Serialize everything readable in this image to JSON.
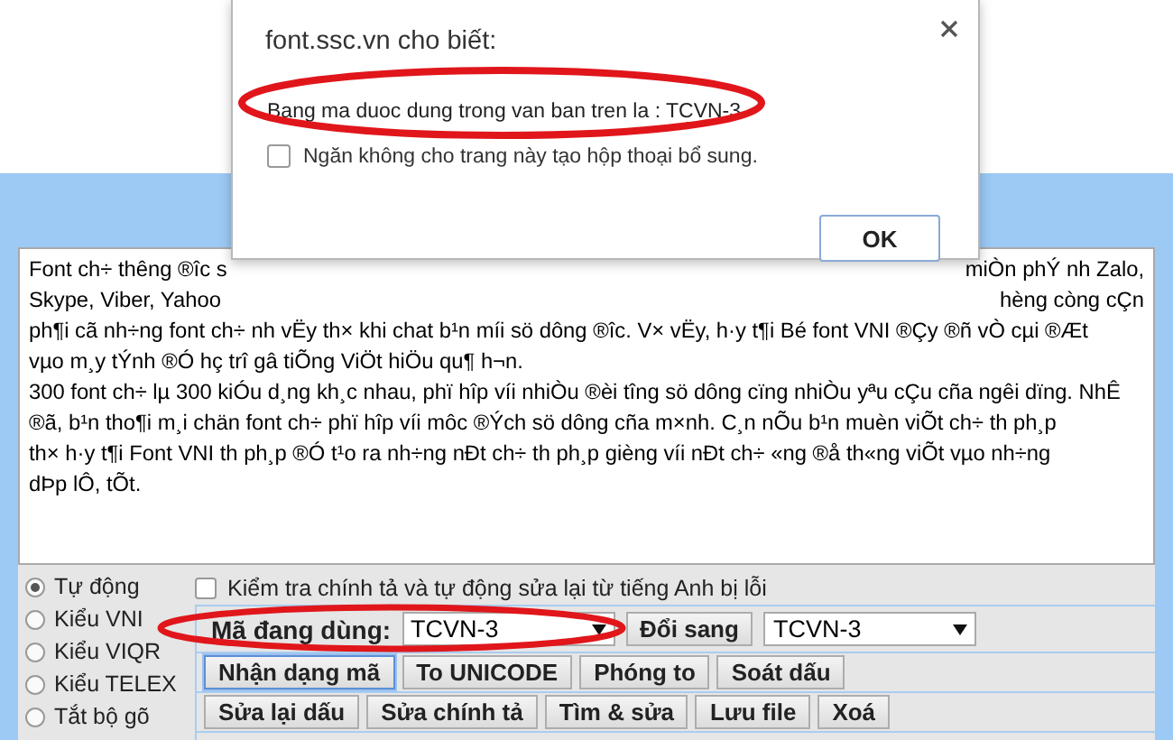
{
  "dialog": {
    "title": "font.ssc.vn cho biết:",
    "message": "Bang ma duoc dung trong van ban tren la : TCVN-3",
    "suppress": {
      "label": "Ngăn không cho trang này tạo hộp thoại bổ sung.",
      "checked": false
    },
    "ok": "OK"
  },
  "editor": {
    "split_lines": [
      {
        "left": "Font ch÷ thêng ®îc s",
        "right": "miÒn phÝ nh Zalo,"
      },
      {
        "left": "Skype, Viber, Yahoo",
        "right": "hèng còng cÇn"
      }
    ],
    "lines": [
      "ph¶i cã nh÷ng font ch÷ nh vËy th× khi chat b¹n míi sö dông ®îc. V× vËy, h·y t¶i Bé font VNI ®Çy ®ñ vÒ cµi ®Æt",
      "vµo m¸y tÝnh ®Ó hç trî gâ tiÕng ViÖt hiÖu qu¶ h¬n.",
      "300 font ch÷ lµ 300 kiÓu d¸ng kh¸c nhau, phï hîp víi nhiÒu ®èi tîng sö dông cïng nhiÒu yªu cÇu cña ngêi dïng. NhÊ",
      "®ã, b¹n tho¶i m¸i chän font ch÷ phï hîp víi môc ®Ých sö dông cña m×nh. C¸n nÕu b¹n muèn viÕt ch÷ th ph¸p",
      "th× h·y t¶i Font VNI th ph¸p ®Ó t¹o ra nh÷ng nÐt ch÷ th ph¸p gièng víi nÐt ch÷ «ng ®å th«ng viÕt vµo nh÷ng",
      "dÞp lÔ, tÕt."
    ]
  },
  "modes": [
    {
      "label": "Tự động",
      "selected": true
    },
    {
      "label": "Kiểu VNI",
      "selected": false
    },
    {
      "label": "Kiểu VIQR",
      "selected": false
    },
    {
      "label": "Kiểu TELEX",
      "selected": false
    },
    {
      "label": "Tắt bộ gõ",
      "selected": false
    }
  ],
  "spellcheck": {
    "label": "Kiểm tra chính tả và tự động sửa lại từ tiếng Anh bị lỗi",
    "checked": false
  },
  "source": {
    "label": "Mã đang dùng:",
    "value": "TCVN-3"
  },
  "convert_button": "Đổi sang",
  "target": {
    "value": "TCVN-3"
  },
  "button_rows": [
    [
      {
        "label": "Nhận dạng mã",
        "focused": true
      },
      {
        "label": "To UNICODE",
        "focused": false
      },
      {
        "label": "Phóng to",
        "focused": false
      },
      {
        "label": "Soát dấu",
        "focused": false
      }
    ],
    [
      {
        "label": "Sửa lại dấu",
        "focused": false
      },
      {
        "label": "Sửa chính tả",
        "focused": false
      },
      {
        "label": "Tìm & sửa",
        "focused": false
      },
      {
        "label": "Lưu file",
        "focused": false
      },
      {
        "label": "Xoá",
        "focused": false
      }
    ]
  ]
}
